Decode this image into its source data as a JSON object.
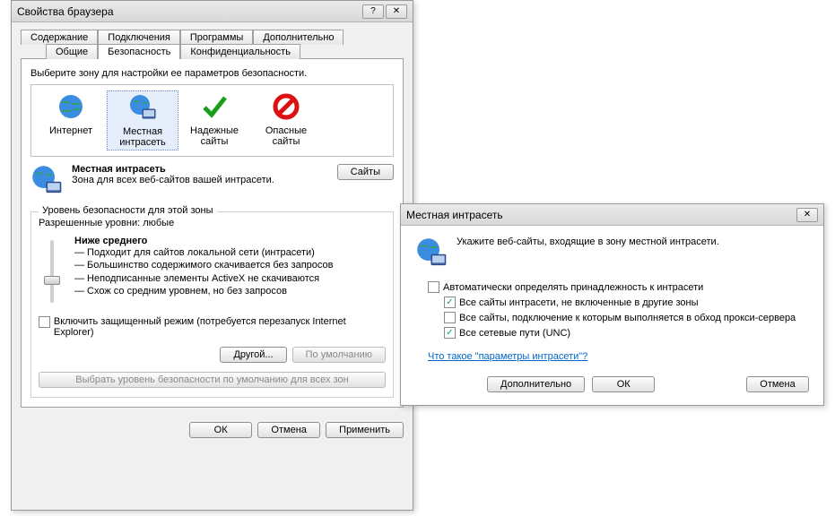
{
  "mainWindow": {
    "title": "Свойства браузера",
    "tabsRow1": [
      "Содержание",
      "Подключения",
      "Программы",
      "Дополнительно"
    ],
    "tabsRow2": [
      "Общие",
      "Безопасность",
      "Конфиденциальность"
    ],
    "activeTab": "Безопасность",
    "zoneSelectLabel": "Выберите зону для настройки ее параметров безопасности.",
    "zones": {
      "internet": {
        "label": "Интернет"
      },
      "intranet": {
        "label": "Местная интрасеть"
      },
      "trusted": {
        "label": "Надежные сайты"
      },
      "restricted": {
        "label": "Опасные сайты"
      }
    },
    "selectedZoneTitle": "Местная интрасеть",
    "selectedZoneDesc": "Зона для всех веб-сайтов вашей интрасети.",
    "sitesButton": "Сайты",
    "securityGroup": {
      "label": "Уровень безопасности для этой зоны",
      "allowedLevels": "Разрешенные уровни: любые",
      "levelName": "Ниже среднего",
      "bullets": [
        "— Подходит для сайтов локальной сети (интрасети)",
        "— Большинство содержимого скачивается без запросов",
        "— Неподписанные элементы ActiveX не скачиваются",
        "— Схож со средним уровнем, но без запросов"
      ],
      "protectedModeLabel": "Включить защищенный режим (потребуется перезапуск Internet Explorer)",
      "customButton": "Другой...",
      "defaultButton": "По умолчанию",
      "resetAllButton": "Выбрать уровень безопасности по умолчанию для всех зон"
    },
    "footer": {
      "ok": "ОК",
      "cancel": "Отмена",
      "apply": "Применить"
    }
  },
  "dialog": {
    "title": "Местная интрасеть",
    "instruction": "Укажите веб-сайты, входящие в зону местной интрасети.",
    "checks": {
      "auto": {
        "label": "Автоматически определять принадлежность к интрасети",
        "checked": false
      },
      "c1": {
        "label": "Все сайты интрасети, не включенные в другие зоны",
        "checked": true
      },
      "c2": {
        "label": "Все сайты, подключение к которым выполняется в обход прокси-сервера",
        "checked": false
      },
      "c3": {
        "label": "Все сетевые пути (UNC)",
        "checked": true
      }
    },
    "link": "Что такое \"параметры интрасети\"?",
    "footer": {
      "advanced": "Дополнительно",
      "ok": "ОК",
      "cancel": "Отмена"
    }
  }
}
